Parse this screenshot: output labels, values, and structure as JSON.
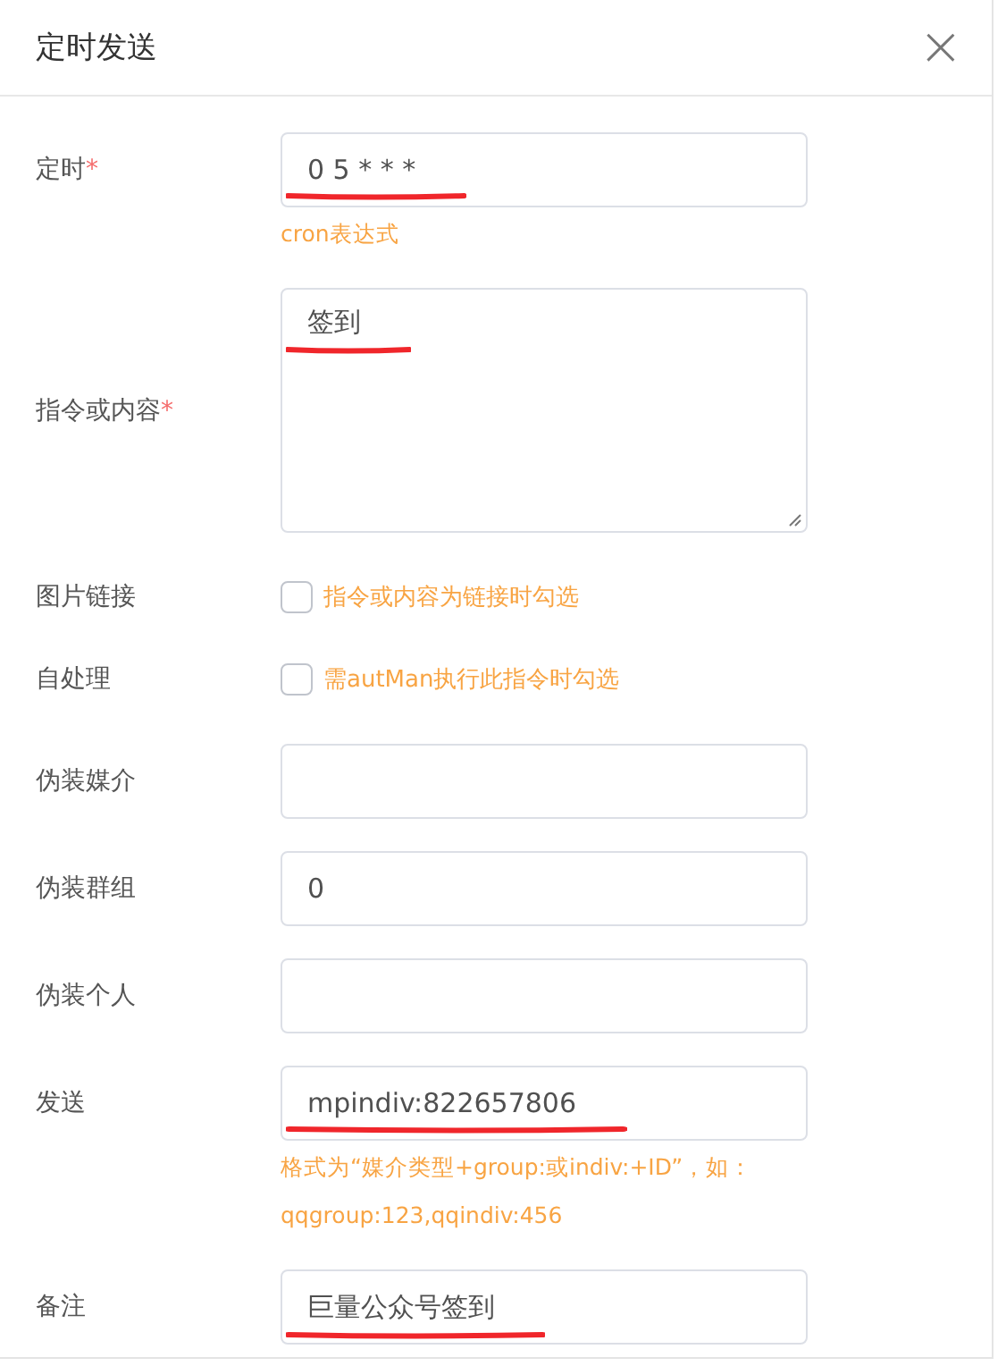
{
  "dialog": {
    "title": "定时发送",
    "close": "×"
  },
  "fields": [
    {
      "kind": "input",
      "label": "定时",
      "required_mark": "*",
      "value": "0 5 * * *",
      "marked": true,
      "hint": "cron表达式"
    },
    {
      "kind": "textarea",
      "label": "指令或内容",
      "required_mark": "*",
      "value": "签到",
      "marked": true
    },
    {
      "kind": "checkbox",
      "label": "图片链接",
      "checked": false,
      "hint": "指令或内容为链接时勾选"
    },
    {
      "kind": "checkbox",
      "label": "自处理",
      "checked": false,
      "hint": "需autMan执行此指令时勾选"
    },
    {
      "kind": "input",
      "label": "伪装媒介"
    },
    {
      "kind": "input",
      "label": "伪装群组",
      "value": "0",
      "marked": false
    },
    {
      "kind": "input",
      "label": "伪装个人"
    },
    {
      "kind": "input",
      "label": "发送",
      "value": "mpindiv:822657806",
      "marked": true,
      "hint": "格式为“媒介类型+group:或indiv:+ID”，如：qqgroup:123,qqindiv:456"
    },
    {
      "kind": "input",
      "label": "备注",
      "value": "巨量公众号签到",
      "marked": true
    }
  ]
}
